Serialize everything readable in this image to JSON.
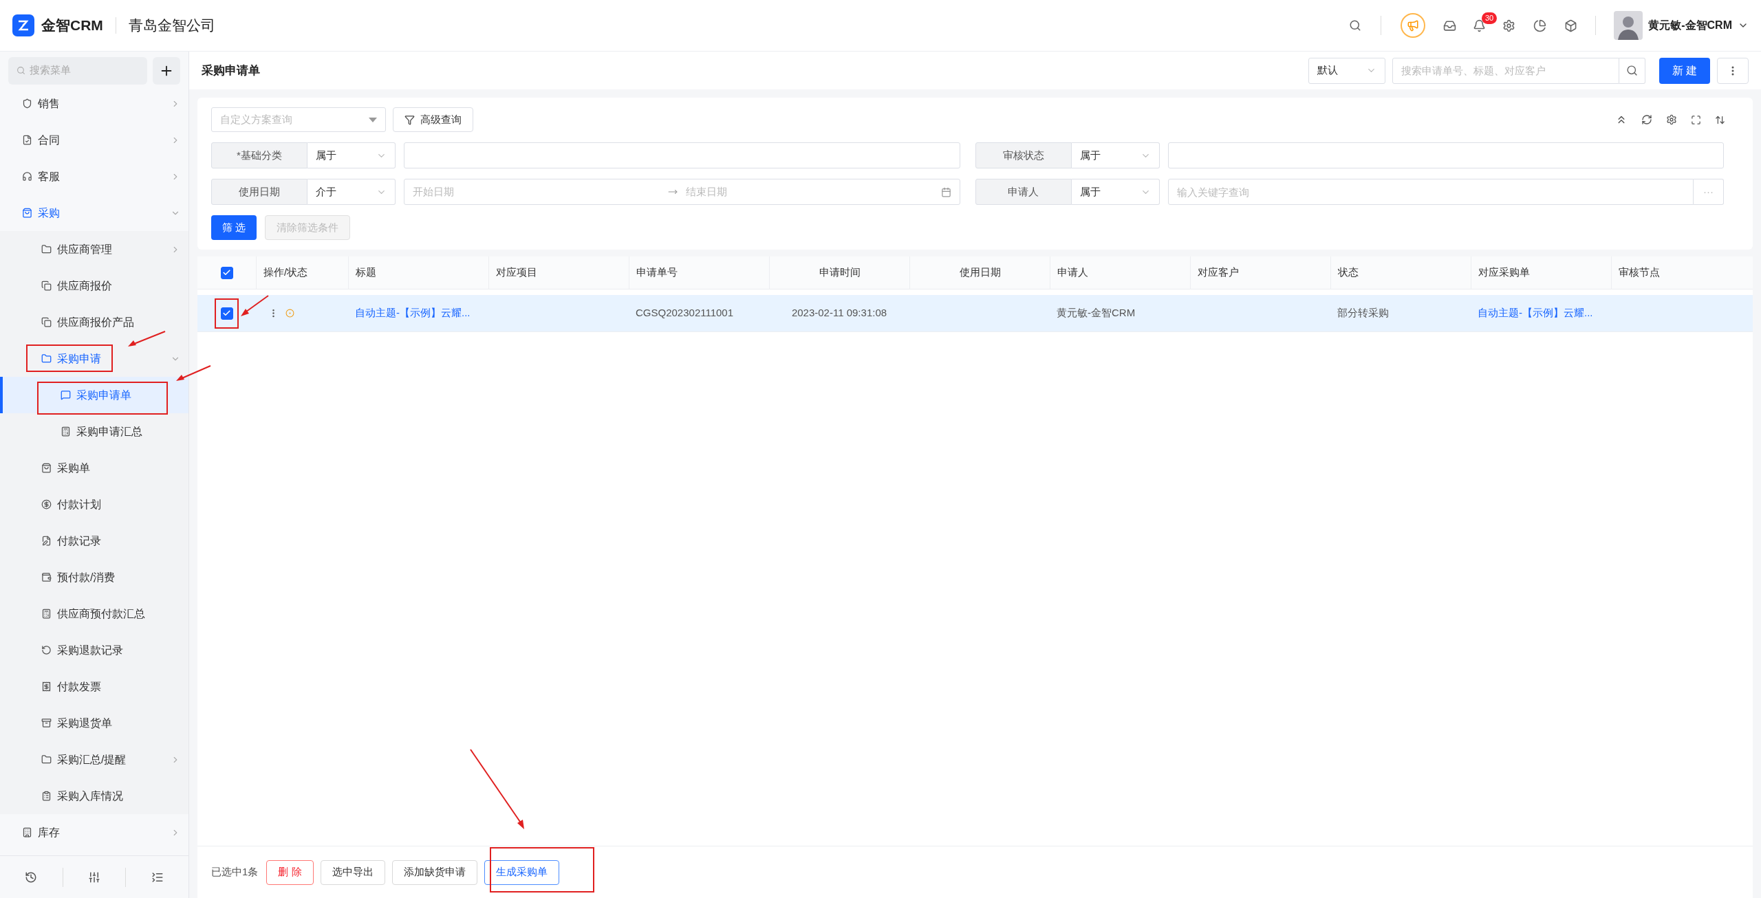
{
  "topbar": {
    "brand": "金智CRM",
    "company": "青岛金智公司",
    "notification_count": "30",
    "user": "黄元敏-金智CRM"
  },
  "sidebar": {
    "search_placeholder": "搜索菜单",
    "items": [
      {
        "label": "销售",
        "kind": "group",
        "expanded": false,
        "selected": false
      },
      {
        "label": "合同",
        "kind": "group",
        "expanded": false,
        "selected": false
      },
      {
        "label": "客服",
        "kind": "group",
        "expanded": false,
        "selected": false
      },
      {
        "label": "采购",
        "kind": "group",
        "expanded": true,
        "selected": false,
        "children": [
          {
            "label": "供应商管理",
            "kind": "group",
            "expanded": false,
            "selected": false
          },
          {
            "label": "供应商报价",
            "kind": "link",
            "selected": false
          },
          {
            "label": "供应商报价产品",
            "kind": "link",
            "selected": false
          },
          {
            "label": "采购申请",
            "kind": "group",
            "expanded": true,
            "selected": false,
            "children": [
              {
                "label": "采购申请单",
                "kind": "link",
                "selected": true
              },
              {
                "label": "采购申请汇总",
                "kind": "link",
                "selected": false
              }
            ]
          },
          {
            "label": "采购单",
            "kind": "link",
            "selected": false
          },
          {
            "label": "付款计划",
            "kind": "link",
            "selected": false
          },
          {
            "label": "付款记录",
            "kind": "link",
            "selected": false
          },
          {
            "label": "预付款/消费",
            "kind": "link",
            "selected": false
          },
          {
            "label": "供应商预付款汇总",
            "kind": "link",
            "selected": false
          },
          {
            "label": "采购退款记录",
            "kind": "link",
            "selected": false
          },
          {
            "label": "付款发票",
            "kind": "link",
            "selected": false
          },
          {
            "label": "采购退货单",
            "kind": "link",
            "selected": false
          },
          {
            "label": "采购汇总/提醒",
            "kind": "group",
            "expanded": false,
            "selected": false
          },
          {
            "label": "采购入库情况",
            "kind": "link",
            "selected": false
          }
        ]
      },
      {
        "label": "库存",
        "kind": "group",
        "expanded": false,
        "selected": false
      }
    ]
  },
  "page": {
    "title": "采购申请单",
    "view_select": "默认",
    "search_placeholder": "搜索申请单号、标题、对应客户",
    "new_button": "新 建"
  },
  "filters": {
    "scheme_placeholder": "自定义方案查询",
    "advanced_button": "高级查询",
    "rows": [
      {
        "left": {
          "label": "*基础分类",
          "operator": "属于",
          "kind": "text"
        },
        "right": {
          "label": "审核状态",
          "operator": "属于",
          "kind": "text"
        }
      },
      {
        "left": {
          "label": "使用日期",
          "operator": "介于",
          "kind": "daterange",
          "start_placeholder": "开始日期",
          "end_placeholder": "结束日期"
        },
        "right": {
          "label": "申请人",
          "operator": "属于",
          "kind": "picker",
          "placeholder": "输入关键字查询",
          "more": "···"
        }
      }
    ],
    "apply_button": "筛 选",
    "clear_button": "清除筛选条件",
    "clear_disabled": true
  },
  "table": {
    "select_all_checked": true,
    "columns": [
      "操作/状态",
      "标题",
      "对应项目",
      "申请单号",
      "申请时间",
      "使用日期",
      "申请人",
      "对应客户",
      "状态",
      "对应采购单",
      "审核节点"
    ],
    "rows": [
      {
        "selected": true,
        "checked": true,
        "title": "自动主题-【示例】云耀...",
        "request_no": "CGSQ202302111001",
        "time": "2023-02-11 09:31:08",
        "applicant": "黄元敏-金智CRM",
        "status": "部分转采购",
        "purchase_order": "自动主题-【示例】云耀..."
      }
    ]
  },
  "bottom_bar": {
    "selection_text": "已选中1条",
    "buttons": [
      {
        "label": "删 除",
        "kind": "danger"
      },
      {
        "label": "选中导出",
        "kind": "default"
      },
      {
        "label": "添加缺货申请",
        "kind": "default"
      },
      {
        "label": "生成采购单",
        "kind": "primary"
      }
    ]
  }
}
